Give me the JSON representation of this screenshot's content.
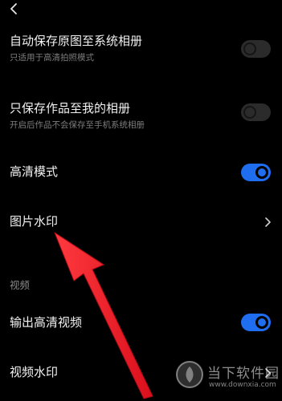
{
  "header": {
    "back_icon": "chevron-left-icon"
  },
  "settings": {
    "auto_save_original": {
      "title": "自动保存原图至系统相册",
      "subtitle": "只适用于高清拍照模式",
      "enabled": false
    },
    "save_to_my_album": {
      "title": "只保存作品至我的相册",
      "subtitle": "开启后作品不会保存至手机系统相册",
      "enabled": false
    },
    "hd_mode": {
      "title": "高清模式",
      "enabled": true
    },
    "image_watermark": {
      "title": "图片水印",
      "icon": "chevron-right-icon"
    }
  },
  "video_section": {
    "header": "视频",
    "hd_video_output": {
      "title": "输出高清视频",
      "enabled": true
    },
    "video_watermark": {
      "title": "视频水印",
      "icon": "chevron-right-icon"
    }
  },
  "watermark_overlay": {
    "name": "当下软件园",
    "url": "www.downxia.com"
  },
  "colors": {
    "background": "#000000",
    "toggle_on": "#1f6ef0",
    "toggle_off": "#2b2b2b",
    "annotation_arrow": "#e8121e",
    "subtitle_text": "#7d7d7d"
  }
}
